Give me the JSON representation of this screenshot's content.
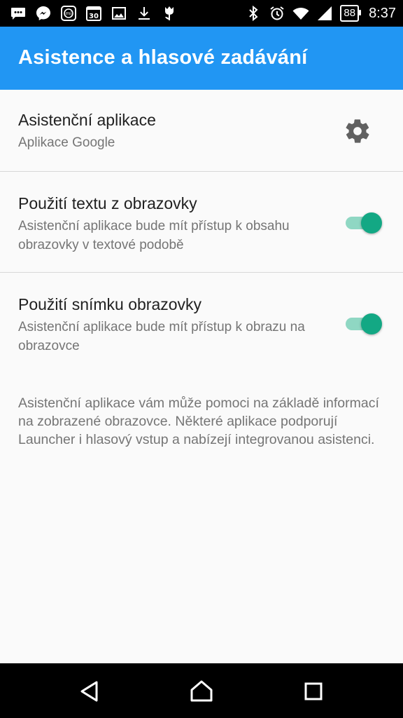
{
  "status_bar": {
    "left_icons": [
      "messages-icon",
      "messenger-icon",
      "mi-fit-icon",
      "calendar-30-icon",
      "gallery-icon",
      "download-icon",
      "tulip-icon"
    ],
    "calendar_day": "30",
    "mi_label": "mi",
    "right_icons": [
      "bluetooth-icon",
      "alarm-icon",
      "wifi-icon",
      "signal-icon"
    ],
    "battery": "88",
    "time": "8:37"
  },
  "app_bar": {
    "title": "Asistence a hlasové zadávání",
    "color": "#2196f3"
  },
  "preferences": [
    {
      "title": "Asistenční aplikace",
      "summary": "Aplikace Google",
      "widget": "gear-icon"
    },
    {
      "title": "Použití textu z obrazovky",
      "summary": "Asistenční aplikace bude mít přístup k obsahu obrazovky v textové podobě",
      "widget": "switch",
      "checked": true
    },
    {
      "title": "Použití snímku obrazovky",
      "summary": "Asistenční aplikace bude mít přístup k obrazu na obrazovce",
      "widget": "switch",
      "checked": true
    }
  ],
  "footer": "Asistenční aplikace vám může pomoci na základě informací na zobrazené obrazovce. Některé aplikace podporují Launcher i hlasový vstup a nabízejí integrovanou asistenci.",
  "accent_color": "#13a884",
  "nav_bar": [
    "back-icon",
    "home-icon",
    "recents-icon"
  ]
}
